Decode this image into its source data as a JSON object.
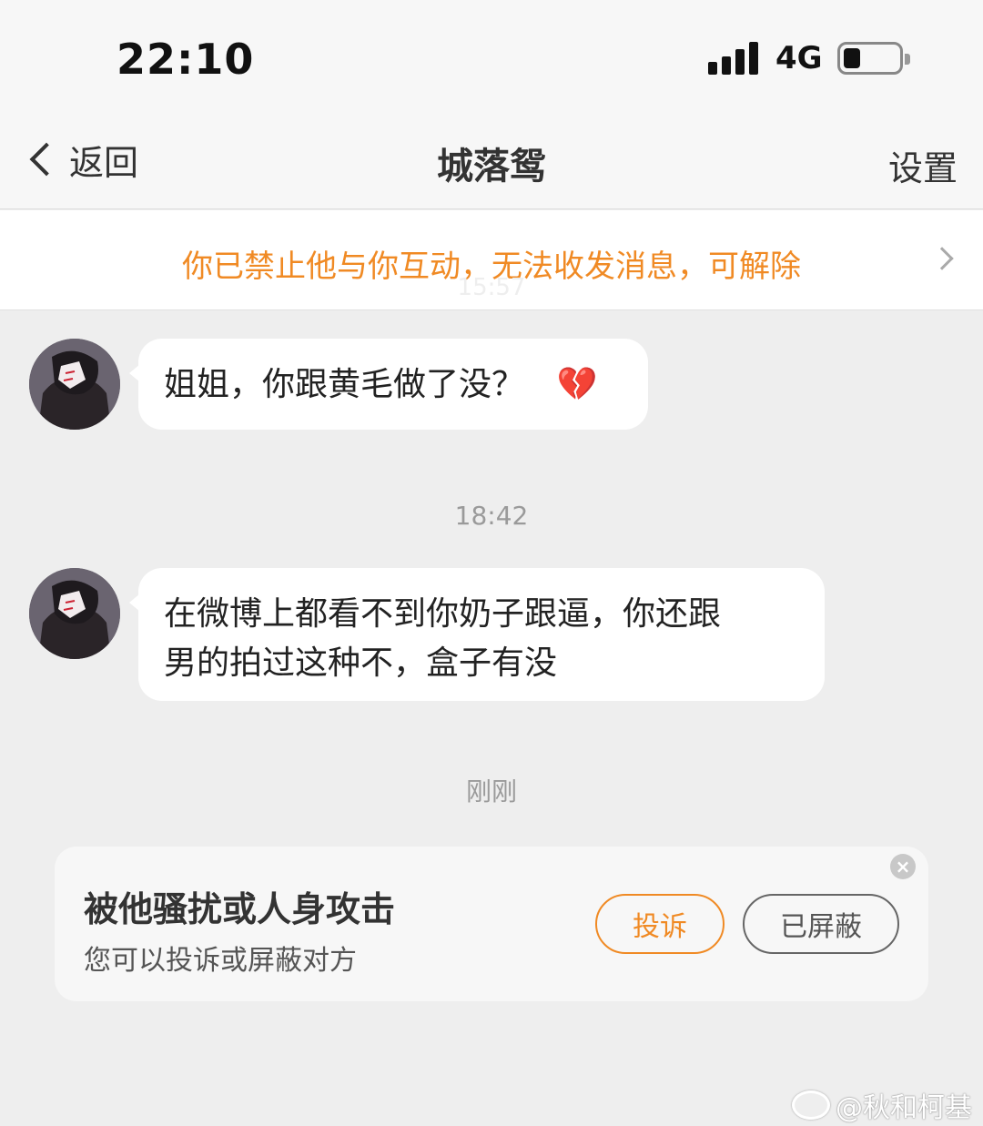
{
  "status_bar": {
    "time": "22:10",
    "network": "4G",
    "battery_level": 0.3
  },
  "nav": {
    "back_label": "返回",
    "title": "城落鸳",
    "settings_label": "设置"
  },
  "banner": {
    "text": "你已禁止他与你互动，无法收发消息，可解除",
    "faded_time": "15:57"
  },
  "messages": [
    {
      "text": "姐姐，你跟黄毛做了没？",
      "emoji": "💔"
    },
    {
      "text_line1": "在微博上都看不到你奶子跟逼，你还跟",
      "text_line2": "男的拍过这种不，盒子有没"
    }
  ],
  "timestamps": [
    "18:42",
    "刚刚"
  ],
  "report_card": {
    "title": "被他骚扰或人身攻击",
    "subtitle": "您可以投诉或屏蔽对方",
    "report_button": "投诉",
    "blocked_button": "已屏蔽"
  },
  "watermark": "@秋和柯基",
  "colors": {
    "accent": "#f08a24",
    "background": "#eeeeee"
  }
}
